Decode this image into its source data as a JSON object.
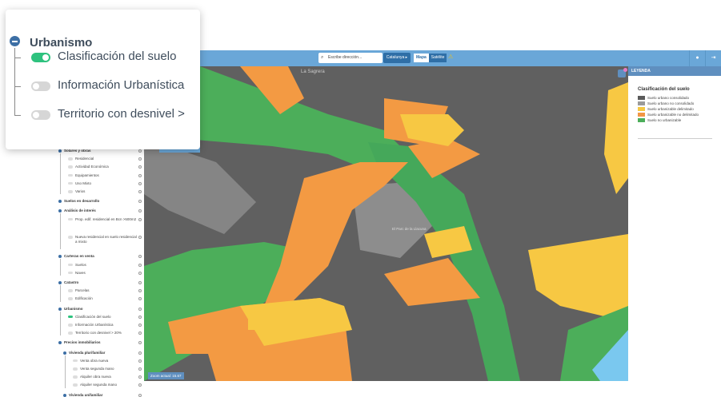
{
  "popup": {
    "title": "Urbanismo",
    "items": [
      {
        "label": "Clasificación del suelo",
        "on": true
      },
      {
        "label": "Información Urbanística",
        "on": false
      },
      {
        "label": "Territorio con desnivel >",
        "on": false
      }
    ]
  },
  "topbar": {
    "search_placeholder": "Escribe dirección...",
    "region": "Catalunya",
    "map_types": [
      "Mapa",
      "Satélite"
    ],
    "selected_map_type": "Mapa"
  },
  "map": {
    "zoom_label": "Zoom actual: 15.67",
    "place_labels": [
      "La Sagrera",
      "El Parc de la Llacuna"
    ]
  },
  "legend": {
    "header": "LEYENDA",
    "title": "Clasificación del suelo",
    "items": [
      {
        "label": "Suelo urbano consolidado",
        "color": "#5a5a5a"
      },
      {
        "label": "Suelo urbano no consolidado",
        "color": "#9a9a9a"
      },
      {
        "label": "Suelo urbanizable delimitado",
        "color": "#f5c842"
      },
      {
        "label": "Suelo urbanizable no delimitado",
        "color": "#f29745"
      },
      {
        "label": "Suelo no urbanizable",
        "color": "#4cae5a"
      }
    ]
  },
  "sidebar": {
    "groups": [
      {
        "label": "Solares y obras",
        "items": [
          "Residencial",
          "Actividad Económica",
          "Equipamientos",
          "Uso Mixto",
          "Varios"
        ]
      },
      {
        "label": "Suelos en desarrollo",
        "items": []
      },
      {
        "label": "Análisis de interés",
        "items": [
          "Prop. edif. residencial en Bcn >500m2",
          "Nueva residencial en suelo residencial a mixto"
        ]
      },
      {
        "label": "Carteras en venta",
        "items": [
          "Suelos",
          "Naves"
        ]
      },
      {
        "label": "Catastro",
        "items": [
          "Parcelas",
          "Edificación"
        ]
      },
      {
        "label": "Urbanismo",
        "items": [
          "Clasificación del suelo",
          "Información Urbanística",
          "Territorio con desnivel > 20%"
        ]
      },
      {
        "label": "Precios inmobiliarios",
        "items": []
      },
      {
        "label": "Vivienda plurifamiliar",
        "items": [
          "Venta obra nueva",
          "Venta segunda mano",
          "Alquiler obra nueva",
          "Alquiler segunda mano"
        ]
      },
      {
        "label": "Vivienda unifamiliar",
        "items": []
      }
    ]
  },
  "colors": {
    "urban": "#5f5f5f",
    "urban_light": "#8f8f8f",
    "yellow": "#f7c843",
    "orange": "#f39a43",
    "green": "#4cae5a",
    "water": "#7ac8ef",
    "bar": "#6aa7d8",
    "accent": "#2ec27e"
  }
}
